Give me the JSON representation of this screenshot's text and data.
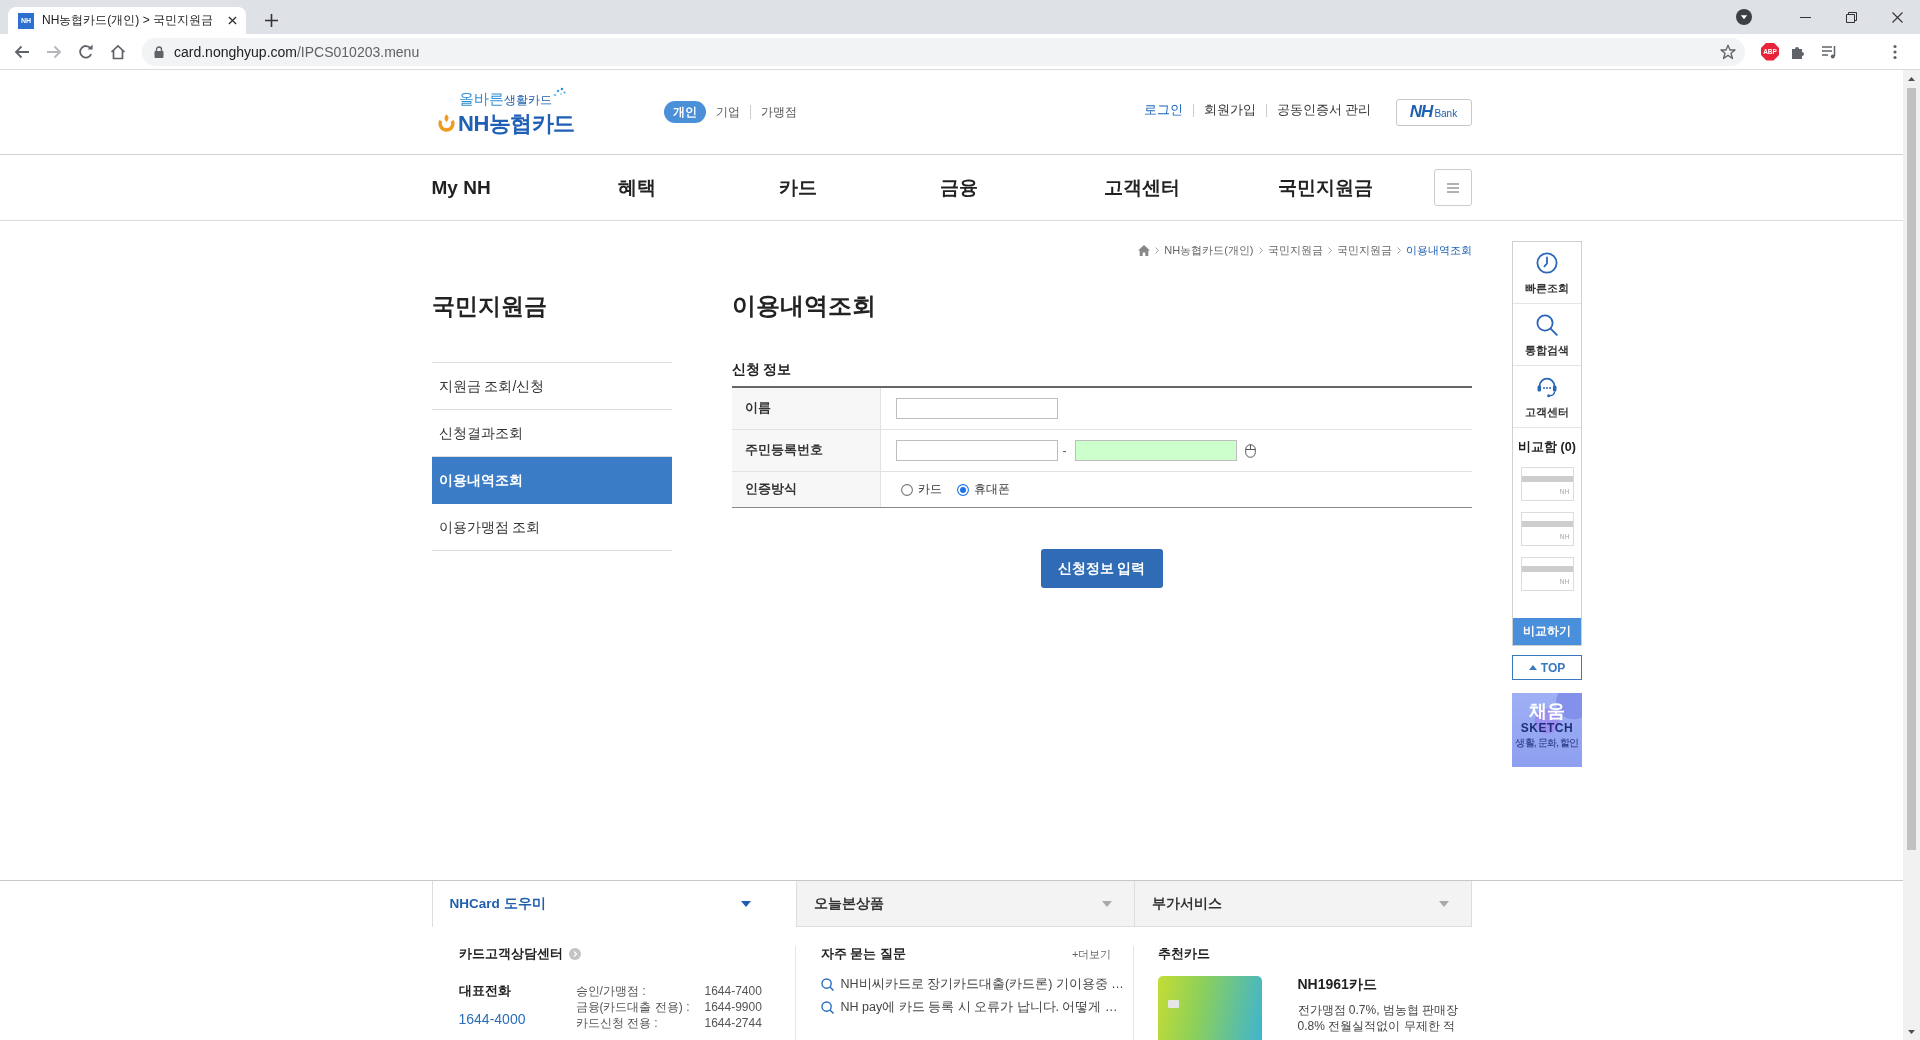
{
  "browser": {
    "tabs": [
      {
        "favicon": "NH",
        "title": "NH농협카드(개인) > 국민지원금",
        "selected": true
      }
    ],
    "address": {
      "host": "card.nonghyup.com",
      "path": "/IPCS010203.menu"
    },
    "extension_badge": "ABP"
  },
  "header": {
    "logo": {
      "tagline_accent": "올바른",
      "tagline": "생활카드",
      "name": "NH농협카드"
    },
    "segments": [
      {
        "label": "개인",
        "selected": true
      },
      {
        "label": "기업",
        "selected": false
      },
      {
        "label": "가맹점",
        "selected": false
      }
    ],
    "links": [
      {
        "label": "로그인",
        "highlight": true
      },
      {
        "label": "회원가입",
        "highlight": false
      },
      {
        "label": "공동인증서 관리",
        "highlight": false
      }
    ],
    "bank_button": {
      "brand": "NH",
      "label": "Bank"
    }
  },
  "nav": [
    "My NH",
    "혜택",
    "카드",
    "금융",
    "고객센터",
    "국민지원금"
  ],
  "breadcrumb": [
    {
      "label": "NH농협카드(개인)",
      "selected": false
    },
    {
      "label": "국민지원금",
      "selected": false
    },
    {
      "label": "국민지원금",
      "selected": false
    },
    {
      "label": "이용내역조회",
      "selected": true
    }
  ],
  "sidebar": {
    "title": "국민지원금",
    "items": [
      {
        "label": "지원금 조회/신청",
        "selected": false
      },
      {
        "label": "신청결과조회",
        "selected": false
      },
      {
        "label": "이용내역조회",
        "selected": true
      },
      {
        "label": "이용가맹점 조회",
        "selected": false
      }
    ]
  },
  "main": {
    "title": "이용내역조회",
    "section_title": "신청 정보",
    "rows": [
      {
        "kind": "text",
        "label": "이름",
        "fields": [
          {
            "highlighted": false
          }
        ]
      },
      {
        "kind": "ssn",
        "label": "주민등록번호",
        "separator": "-",
        "fields": [
          {
            "highlighted": false
          },
          {
            "highlighted": true
          }
        ]
      },
      {
        "kind": "radio",
        "label": "인증방식",
        "options": [
          {
            "label": "카드",
            "selected": false
          },
          {
            "label": "휴대폰",
            "selected": true
          }
        ]
      }
    ],
    "submit": "신청정보 입력"
  },
  "quick_menu": {
    "items": [
      {
        "label": "빠른조회"
      },
      {
        "label": "통합검색"
      },
      {
        "label": "고객센터"
      }
    ],
    "compare": {
      "title": "비교함 (0)",
      "slots": [
        "NH",
        "NH",
        "NH"
      ],
      "button": "비교하기"
    },
    "top_button": "TOP",
    "banner": {
      "title": "채움",
      "subtitle": "SKETCH",
      "caption": "생활, 문화, 할인"
    }
  },
  "footer": {
    "tabs": [
      {
        "label": "NHCard 도우미",
        "selected": true
      },
      {
        "label": "오늘본상품",
        "selected": false
      },
      {
        "label": "부가서비스",
        "selected": false
      }
    ],
    "helpdesk": {
      "title": "카드고객상담센터",
      "main_label": "대표전화",
      "main_number": "1644-4000",
      "lines": [
        {
          "label": "승인/가맹점 :",
          "number": "1644-7400"
        },
        {
          "label": "금융(카드대출 전용) :",
          "number": "1644-9900"
        },
        {
          "label": "카드신청 전용 :",
          "number": "1644-2744"
        }
      ]
    },
    "faq": {
      "title": "자주 묻는 질문",
      "more": "+더보기",
      "items": [
        "NH비씨카드로 장기카드대출(카드론) 기이용중 …",
        "NH pay에 카드 등록 시 오류가 납니다. 어떻게 …"
      ]
    },
    "recommend": {
      "title": "추천카드",
      "card_name": "NH1961카드",
      "description": [
        "전가맹점 0.7%, 범농협 판매장",
        "0.8% 전월실적없이 무제한 적"
      ]
    }
  }
}
